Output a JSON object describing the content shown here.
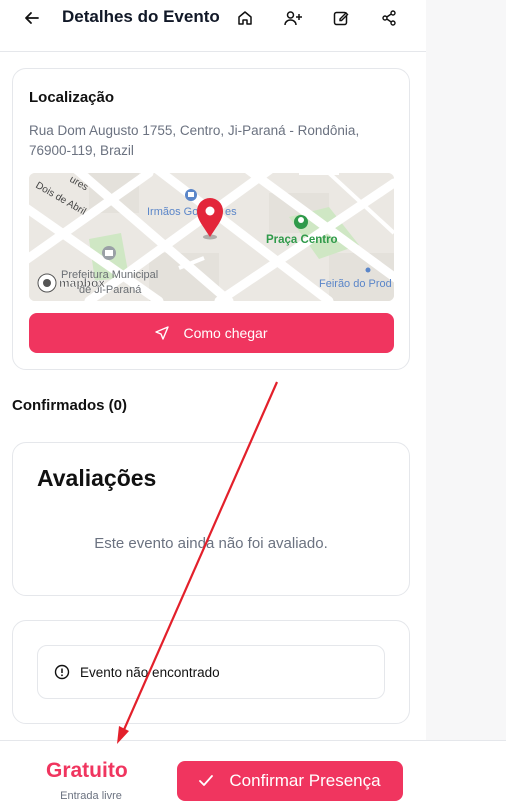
{
  "header": {
    "title": "Detalhes do Evento",
    "icons": [
      "arrow-left-icon",
      "home-icon",
      "user-plus-icon",
      "edit-icon",
      "share-icon"
    ]
  },
  "location": {
    "title": "Localização",
    "address": "Rua Dom Augusto 1755, Centro, Ji-Paraná - Rondônia, 76900-119, Brazil",
    "map": {
      "labels": {
        "street_1": "Dois de Abril",
        "street_2": "ures",
        "poi_1": "Irmãos Go",
        "poi_1b": "es",
        "poi_2": "Praça Centro",
        "poi_3": "Feirão do Prod",
        "poi_4_line1": "Prefeitura Municipal",
        "poi_4_line2": "de Ji-Paraná",
        "brand": "mapbox"
      }
    },
    "route_button": "Como chegar"
  },
  "confirmed": {
    "label": "Confirmados (0)"
  },
  "reviews": {
    "title": "Avaliações",
    "empty_text": "Este evento ainda não foi avaliado."
  },
  "error": {
    "message": "Evento não encontrado"
  },
  "footer": {
    "price": "Gratuito",
    "price_note": "Entrada livre",
    "confirm_button": "Confirmar Presença"
  },
  "colors": {
    "accent": "#f0355f",
    "annotation_arrow": "#e3202b",
    "map_green": "#2f9a4a",
    "map_blue": "#5b86c9"
  }
}
